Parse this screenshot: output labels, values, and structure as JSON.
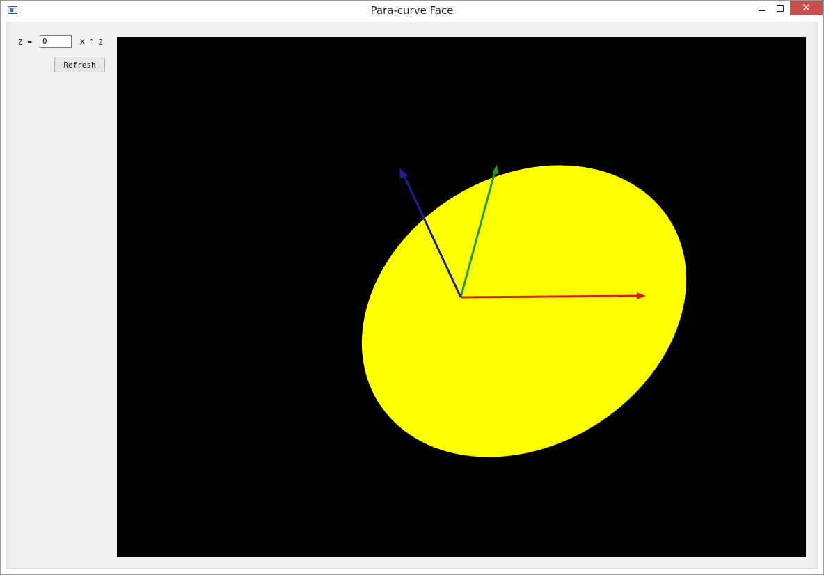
{
  "window": {
    "title": "Para-curve Face",
    "icon": "app-window-icon",
    "minimize_icon": "minimize-icon",
    "maximize_icon": "maximize-icon",
    "close_icon": "close-icon",
    "close_glyph": "✕"
  },
  "controls": {
    "z_label": "Z =",
    "z_value": "0",
    "x_label": "X ^ 2",
    "refresh_label": "Refresh"
  },
  "scene": {
    "background_color": "#000000",
    "surface_color": "#ffff00",
    "axes": [
      {
        "name": "x-axis",
        "color": "#d42020"
      },
      {
        "name": "y-axis",
        "color": "#1f9a1f"
      },
      {
        "name": "z-axis",
        "color": "#1e1e9e"
      }
    ]
  }
}
